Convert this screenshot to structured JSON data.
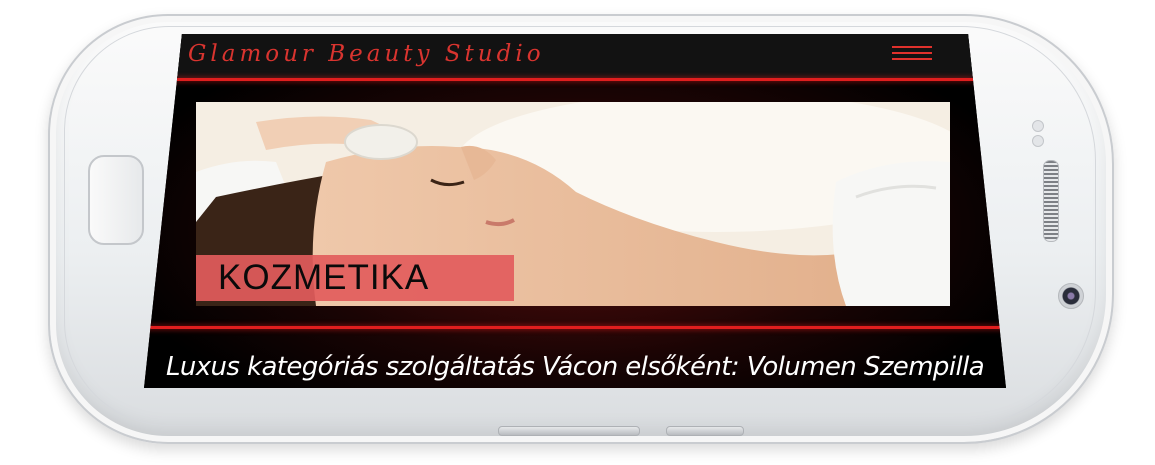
{
  "header": {
    "brand": "Glamour Beauty Studio"
  },
  "hero": {
    "label": "KOZMETIKA"
  },
  "tagline": "Luxus kategóriás szolgáltatás Vácon elsőként:  Volumen Szempilla",
  "icons": {
    "menu": "hamburger-icon",
    "home": "home-button-icon",
    "camera": "front-camera-icon",
    "speaker": "speaker-grille-icon"
  },
  "colors": {
    "accent": "#e01e1e",
    "brand_text": "#d9342f",
    "label_bg": "#e25c5c",
    "screen_bg": "#000000"
  }
}
